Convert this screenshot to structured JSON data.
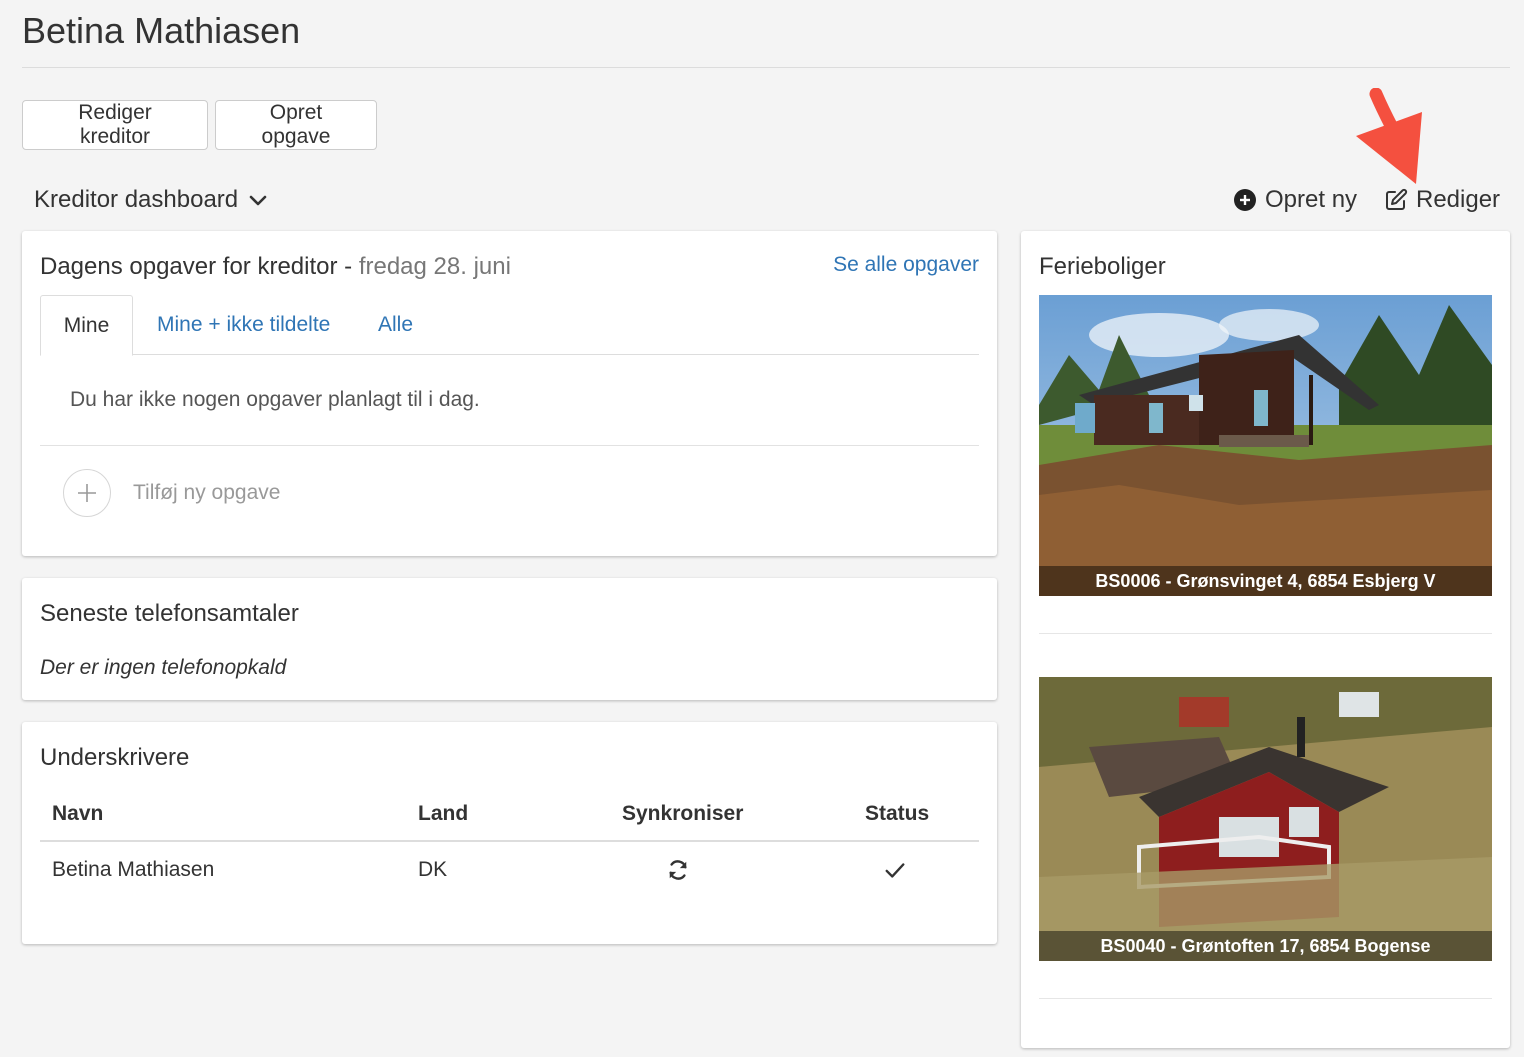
{
  "page": {
    "title": "Betina Mathiasen"
  },
  "toolbar": {
    "edit_creditor": "Rediger kreditor",
    "create_task": "Opret opgave"
  },
  "dashboard": {
    "selector_label": "Kreditor dashboard",
    "create_new": "Opret ny",
    "edit": "Rediger"
  },
  "tasks_card": {
    "title": "Dagens opgaver for kreditor",
    "separator": " - ",
    "date": "fredag 28. juni",
    "see_all": "Se alle opgaver",
    "tabs": [
      {
        "label": "Mine",
        "active": true
      },
      {
        "label": "Mine + ikke tildelte",
        "active": false
      },
      {
        "label": "Alle",
        "active": false
      }
    ],
    "empty_message": "Du har ikke nogen opgaver planlagt til i dag.",
    "add_task": "Tilføj ny opgave"
  },
  "calls_card": {
    "title": "Seneste telefonsamtaler",
    "empty_message": "Der er ingen telefonopkald"
  },
  "signers_card": {
    "title": "Underskrivere",
    "columns": [
      "Navn",
      "Land",
      "Synkroniser",
      "Status"
    ],
    "rows": [
      {
        "name": "Betina Mathiasen",
        "country": "DK",
        "sync_icon": "sync-icon",
        "status_icon": "check-icon"
      }
    ]
  },
  "houses_card": {
    "title": "Ferieboliger",
    "houses": [
      {
        "caption": "BS0006 - Grønsvinget 4, 6854 Esbjerg V"
      },
      {
        "caption": "BS0040 - Grøntoften 17, 6854 Bogense"
      }
    ]
  },
  "colors": {
    "link": "#2f75b5",
    "annotation_arrow": "#f4503f"
  }
}
